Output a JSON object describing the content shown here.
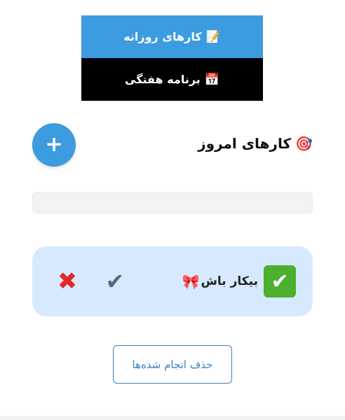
{
  "nav": {
    "daily": {
      "icon": "📝",
      "label": "کارهای روزانه"
    },
    "weekly": {
      "icon": "📅",
      "label": "برنامه هفتگی"
    }
  },
  "header": {
    "title_icon": "🎯",
    "title": "کارهای امروز",
    "add_label": "+"
  },
  "input": {
    "placeholder": "",
    "value": ""
  },
  "tasks": [
    {
      "status_icon": "✔",
      "text": "بیکار باش",
      "emoji": "🎀",
      "done_icon": "✔",
      "delete_icon": "✖"
    }
  ],
  "footer": {
    "clear_label": "حذف انجام شده‌ها"
  },
  "colors": {
    "accent": "#3d9be0",
    "card_bg": "#d6e9fe",
    "success": "#4caf2d",
    "danger": "#e02a2a"
  }
}
